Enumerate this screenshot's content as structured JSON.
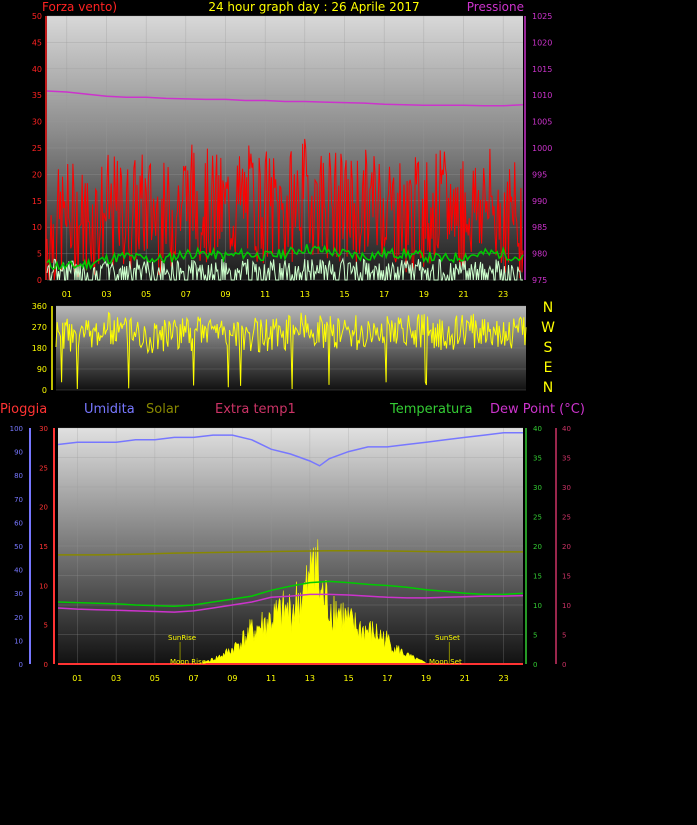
{
  "header": {
    "title": "24 hour graph day : 26 Aprile 2017",
    "left_label": "Forza vento)",
    "right_label": "Pressione"
  },
  "compass": [
    "N",
    "W",
    "S",
    "E",
    "N"
  ],
  "bottom_legend": {
    "pioggia": "Pioggia",
    "umidita": "Umidita",
    "solar": "Solar",
    "extra": "Extra temp1",
    "temperatura": "Temperatura",
    "dew": "Dew Point (°C)"
  },
  "annotations": {
    "sunrise": "SunRise",
    "sunset": "SunSet",
    "moonrise": "Moon Rise",
    "moonset": "Moon Set"
  },
  "colors": {
    "wind": "#ff0000",
    "gust": "#00cc00",
    "wind_low": "#ccffcc",
    "pressure": "#cc33cc",
    "direction": "#ffff00",
    "humidity": "#7777ff",
    "solar": "#ffff00",
    "solar_max": "#888800",
    "temperature": "#00cc00",
    "dew": "#cc33cc",
    "rain": "#ff3333"
  },
  "chart_data": [
    {
      "type": "line",
      "title": "24 hour graph day : 26 Aprile 2017",
      "x_ticks": [
        "01",
        "03",
        "05",
        "07",
        "09",
        "11",
        "13",
        "15",
        "17",
        "19",
        "21",
        "23"
      ],
      "xlim_hours": [
        0,
        24
      ],
      "y_left": {
        "label": "Forza vento)",
        "ylim": [
          0,
          50
        ],
        "ticks": [
          0,
          5,
          10,
          15,
          20,
          25,
          30,
          35,
          40,
          45,
          50
        ]
      },
      "y_right": {
        "label": "Pressione",
        "ylim": [
          975,
          1025
        ],
        "ticks": [
          975,
          980,
          985,
          990,
          995,
          1000,
          1005,
          1010,
          1015,
          1020,
          1025
        ]
      },
      "series": [
        {
          "name": "Pressione",
          "axis": "right",
          "hours": [
            0,
            1,
            2,
            3,
            4,
            5,
            6,
            7,
            8,
            9,
            10,
            11,
            12,
            13,
            14,
            15,
            16,
            17,
            18,
            19,
            20,
            21,
            22,
            23,
            24
          ],
          "values": [
            1010.8,
            1010.6,
            1010.2,
            1009.8,
            1009.6,
            1009.6,
            1009.4,
            1009.3,
            1009.2,
            1009.2,
            1009.0,
            1009.0,
            1008.8,
            1008.8,
            1008.7,
            1008.6,
            1008.5,
            1008.3,
            1008.2,
            1008.1,
            1008.1,
            1008.1,
            1008.0,
            1008.0,
            1008.2
          ]
        },
        {
          "axis": "left",
          "hours": [
            0,
            1,
            2,
            3,
            4,
            5,
            6,
            7,
            8,
            9,
            10,
            11,
            12,
            13,
            14,
            15,
            16,
            17,
            18,
            19,
            20,
            21,
            22,
            23,
            24
          ],
          "values": [
            8,
            12,
            11,
            13,
            12,
            14,
            11,
            16,
            14,
            13,
            15,
            14,
            13,
            16,
            15,
            13,
            14,
            15,
            12,
            13,
            14,
            13,
            15,
            12,
            11
          ]
        },
        {
          "axis": "left",
          "hours": [
            0,
            1,
            2,
            3,
            4,
            5,
            6,
            7,
            8,
            9,
            10,
            11,
            12,
            13,
            14,
            15,
            16,
            17,
            18,
            19,
            20,
            21,
            22,
            23,
            24
          ],
          "values": [
            3,
            2.5,
            3,
            4,
            4.5,
            4,
            4,
            5,
            5,
            4.5,
            5,
            4.5,
            5,
            6,
            5.5,
            5,
            4.5,
            5,
            5,
            4.5,
            4,
            4.5,
            5,
            5,
            4
          ]
        }
      ]
    },
    {
      "type": "line",
      "y": {
        "ylim": [
          0,
          360
        ],
        "ticks": [
          0,
          90,
          180,
          270,
          360
        ]
      },
      "series": [
        {
          "hours": [
            0,
            1,
            2,
            3,
            4,
            5,
            6,
            7,
            8,
            9,
            10,
            11,
            12,
            13,
            14,
            15,
            16,
            17,
            18,
            19,
            20,
            21,
            22,
            23,
            24
          ],
          "values": [
            240,
            230,
            250,
            260,
            240,
            230,
            250,
            240,
            260,
            250,
            240,
            235,
            250,
            270,
            245,
            250,
            240,
            260,
            250,
            255,
            240,
            250,
            260,
            245,
            250
          ]
        }
      ]
    },
    {
      "type": "line",
      "x_ticks": [
        "01",
        "03",
        "05",
        "07",
        "09",
        "11",
        "13",
        "15",
        "17",
        "19",
        "21",
        "23"
      ],
      "axes": {
        "pioggia": {
          "label": "Pioggia",
          "ylim": [
            0,
            30
          ],
          "ticks": [
            0,
            5,
            10,
            15,
            20,
            25,
            30
          ]
        },
        "umidita": {
          "label": "Umidita",
          "ylim": [
            0,
            100
          ],
          "ticks": [
            0,
            10,
            20,
            30,
            40,
            50,
            60,
            70,
            80,
            90,
            100
          ]
        },
        "temperatura": {
          "label": "Temperatura",
          "ylim": [
            0,
            40
          ],
          "ticks": [
            0,
            5,
            10,
            15,
            20,
            25,
            30,
            35,
            40
          ]
        },
        "dew": {
          "label": "Dew Point (°C)",
          "ylim": [
            0,
            40
          ],
          "ticks": [
            0,
            5,
            10,
            15,
            20,
            25,
            30,
            35,
            40
          ]
        }
      },
      "series": [
        {
          "name": "Umidita",
          "axis": "umidita",
          "hours": [
            0,
            1,
            2,
            3,
            4,
            5,
            6,
            7,
            8,
            9,
            10,
            11,
            12,
            13,
            13.5,
            14,
            15,
            16,
            17,
            18,
            19,
            20,
            21,
            22,
            23,
            24
          ],
          "values": [
            93,
            94,
            94,
            94,
            95,
            95,
            96,
            96,
            97,
            97,
            95,
            91,
            89,
            86,
            84,
            87,
            90,
            92,
            92,
            93,
            94,
            95,
            96,
            97,
            98,
            98
          ]
        },
        {
          "name": "Solar",
          "axis": "temperatura",
          "hours": [
            0,
            2,
            4,
            6,
            8,
            10,
            12,
            14,
            16,
            18,
            20,
            22,
            24
          ],
          "values": [
            18.5,
            18.5,
            18.6,
            18.8,
            18.9,
            19.0,
            19.1,
            19.2,
            19.2,
            19.1,
            19.0,
            19.0,
            19.0
          ]
        },
        {
          "name": "Temperatura",
          "axis": "temperatura",
          "hours": [
            0,
            1,
            2,
            3,
            4,
            5,
            6,
            7,
            8,
            9,
            10,
            11,
            12,
            13,
            14,
            15,
            16,
            17,
            18,
            19,
            20,
            21,
            22,
            23,
            24
          ],
          "values": [
            10.5,
            10.4,
            10.3,
            10.2,
            10.0,
            9.9,
            9.8,
            10.0,
            10.5,
            11.0,
            11.5,
            12.5,
            13.2,
            13.8,
            14.0,
            13.8,
            13.5,
            13.3,
            13.0,
            12.6,
            12.3,
            12.0,
            11.8,
            11.8,
            12.0
          ]
        },
        {
          "name": "Dew Point (°C)",
          "axis": "dew",
          "hours": [
            0,
            1,
            2,
            3,
            4,
            5,
            6,
            7,
            8,
            9,
            10,
            11,
            12,
            13,
            14,
            15,
            16,
            17,
            18,
            19,
            20,
            21,
            22,
            23,
            24
          ],
          "values": [
            9.5,
            9.3,
            9.2,
            9.1,
            9.0,
            8.9,
            8.8,
            9.0,
            9.5,
            10.0,
            10.5,
            11.3,
            11.5,
            11.8,
            11.8,
            11.7,
            11.5,
            11.3,
            11.2,
            11.2,
            11.3,
            11.4,
            11.5,
            11.5,
            11.6
          ]
        },
        {
          "name": "Solar",
          "axis": "temperatura",
          "hours": [
            7.5,
            8,
            8.5,
            9,
            9.5,
            10,
            10.5,
            11,
            11.5,
            12,
            12.5,
            13,
            13.2,
            13.5,
            14,
            14.5,
            15,
            15.5,
            16,
            16.5,
            17,
            17.5,
            18,
            18.5,
            19
          ],
          "values": [
            0.3,
            0.8,
            1.5,
            2.5,
            4,
            5.5,
            6.5,
            7.5,
            8.5,
            9,
            11,
            13,
            23,
            12,
            10,
            9,
            7,
            6,
            5.5,
            5,
            4,
            2.5,
            1.5,
            0.8,
            0.2
          ]
        },
        {
          "name": "Pioggia",
          "axis": "pioggia",
          "hours": [
            0,
            24
          ],
          "values": [
            0,
            0
          ]
        }
      ]
    }
  ]
}
